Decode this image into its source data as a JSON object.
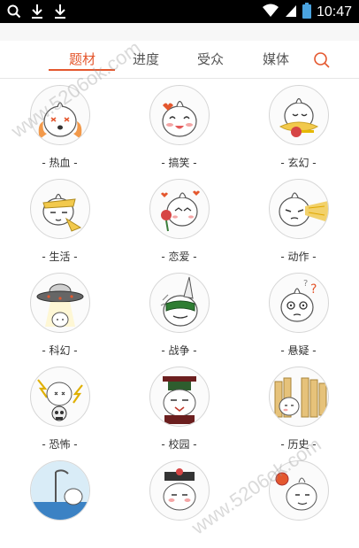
{
  "status_bar": {
    "time": "10:47",
    "left_icons": [
      "search-icon",
      "download-icon",
      "download-icon"
    ],
    "right_icons": [
      "wifi-icon",
      "signal-icon",
      "battery-icon"
    ]
  },
  "tabs": [
    {
      "label": "题材",
      "active": true
    },
    {
      "label": "进度",
      "active": false
    },
    {
      "label": "受众",
      "active": false
    },
    {
      "label": "媒体",
      "active": false
    }
  ],
  "categories": [
    {
      "label": "- 热血 -"
    },
    {
      "label": "- 搞笑 -"
    },
    {
      "label": "- 玄幻 -"
    },
    {
      "label": "- 生活 -"
    },
    {
      "label": "- 恋爱 -"
    },
    {
      "label": "- 动作 -"
    },
    {
      "label": "- 科幻 -"
    },
    {
      "label": "- 战争 -"
    },
    {
      "label": "- 悬疑 -"
    },
    {
      "label": "- 恐怖 -"
    },
    {
      "label": "- 校园 -"
    },
    {
      "label": "- 历史 -"
    },
    {
      "label": ""
    },
    {
      "label": ""
    },
    {
      "label": ""
    }
  ],
  "watermark": "www.5206ok.com",
  "colors": {
    "accent": "#e4572e",
    "status_bar": "#000000",
    "battery": "#4aa3df"
  }
}
